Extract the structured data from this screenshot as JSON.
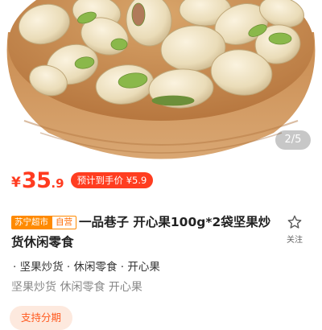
{
  "gallery": {
    "pager": "2/5",
    "image_alt": "pistachios in wooden bowl"
  },
  "price": {
    "currency": "¥",
    "integer": "35",
    "decimal": ".9",
    "estimate_label": "预计到手价 ¥5.9"
  },
  "title": {
    "store_tag": "苏宁超市",
    "self_tag": "自营",
    "text": "一品巷子 开心果100g*2袋坚果炒货休闲零食"
  },
  "follow": {
    "label": "关注",
    "icon": "star-icon"
  },
  "category": {
    "path": "· 坚果炒货 · 休闲零食 · 开心果",
    "keywords": "坚果炒货 休闲零食 开心果"
  },
  "installment": {
    "label": "支持分期"
  },
  "colors": {
    "price_red": "#ff3b1f",
    "tag_orange": "#ff8a00",
    "installment_bg": "#fde9de"
  }
}
